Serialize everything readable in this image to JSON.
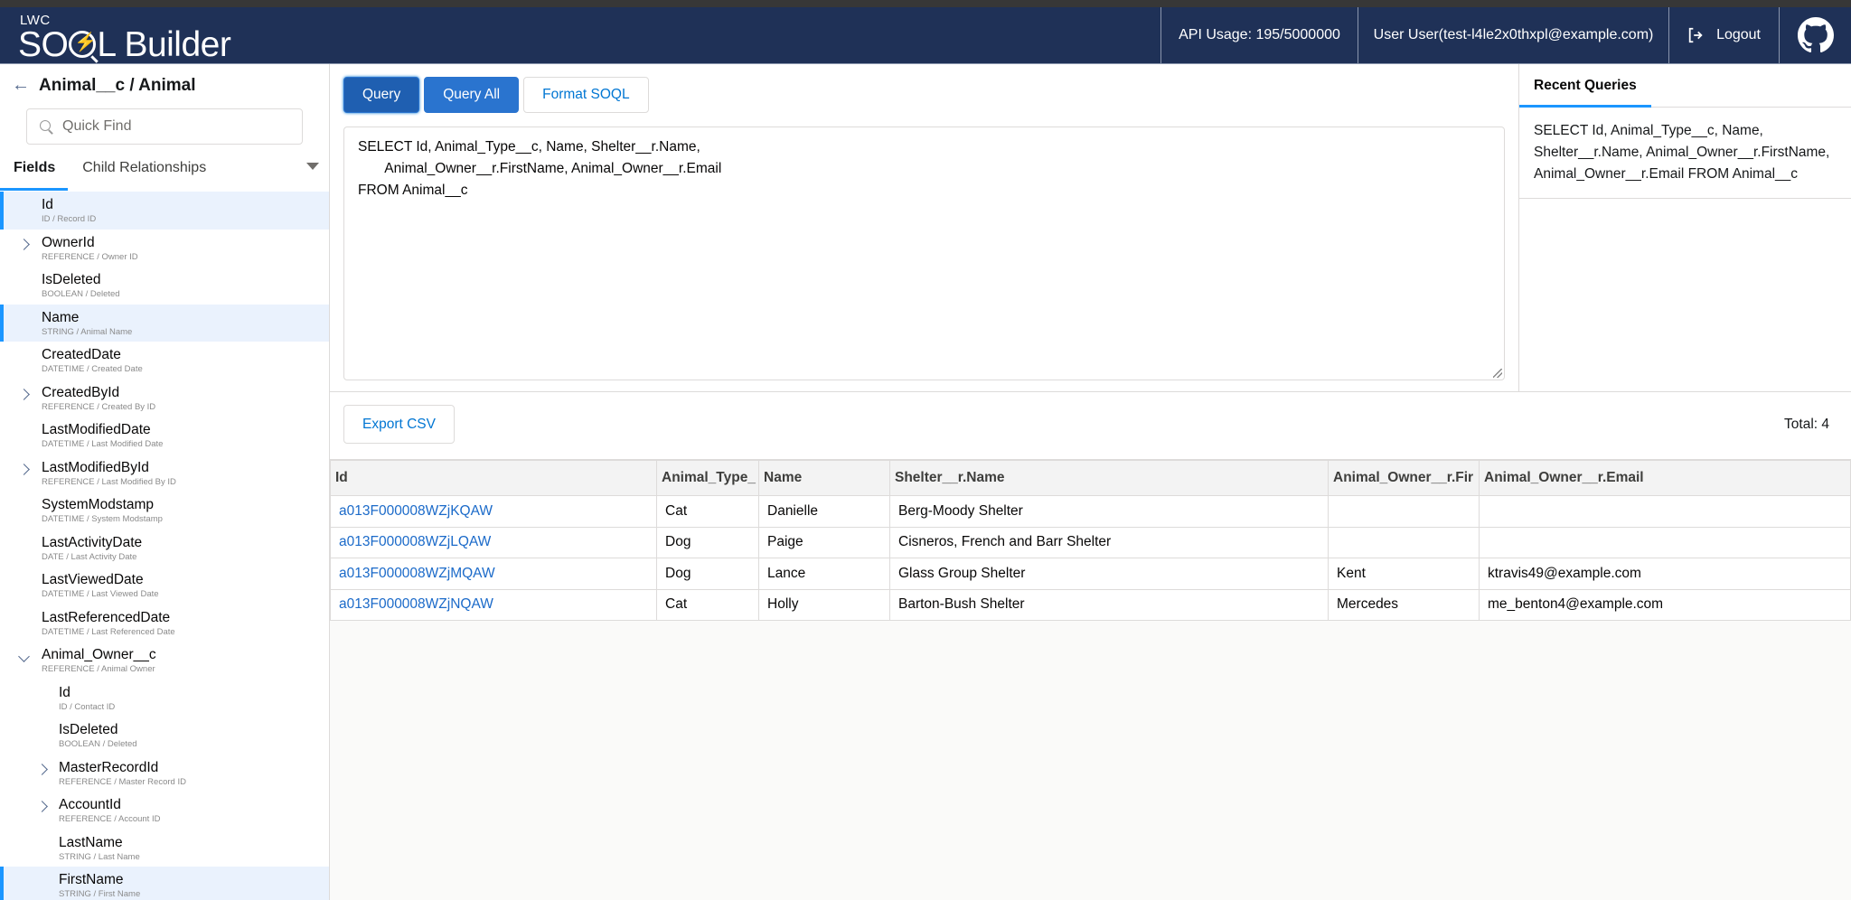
{
  "header": {
    "logo_small": "LWC",
    "logo_title_a": "SO",
    "logo_title_b": "L Builder",
    "api_usage": "API Usage: 195/5000000",
    "user": "User User(test-l4le2x0thxpl@example.com)",
    "logout_label": "Logout"
  },
  "sidebar": {
    "object_title": "Animal__c / Animal",
    "quick_find_placeholder": "Quick Find",
    "tabs": [
      "Fields",
      "Child Relationships"
    ],
    "fields": [
      {
        "name": "Id",
        "desc": "ID / Record ID",
        "level": 0,
        "expand": "none",
        "selected": true
      },
      {
        "name": "OwnerId",
        "desc": "REFERENCE / Owner ID",
        "level": 0,
        "expand": "collapsed",
        "selected": false
      },
      {
        "name": "IsDeleted",
        "desc": "BOOLEAN / Deleted",
        "level": 0,
        "expand": "none",
        "selected": false
      },
      {
        "name": "Name",
        "desc": "STRING / Animal Name",
        "level": 0,
        "expand": "none",
        "selected": true
      },
      {
        "name": "CreatedDate",
        "desc": "DATETIME / Created Date",
        "level": 0,
        "expand": "none",
        "selected": false
      },
      {
        "name": "CreatedById",
        "desc": "REFERENCE / Created By ID",
        "level": 0,
        "expand": "collapsed",
        "selected": false
      },
      {
        "name": "LastModifiedDate",
        "desc": "DATETIME / Last Modified Date",
        "level": 0,
        "expand": "none",
        "selected": false
      },
      {
        "name": "LastModifiedById",
        "desc": "REFERENCE / Last Modified By ID",
        "level": 0,
        "expand": "collapsed",
        "selected": false
      },
      {
        "name": "SystemModstamp",
        "desc": "DATETIME / System Modstamp",
        "level": 0,
        "expand": "none",
        "selected": false
      },
      {
        "name": "LastActivityDate",
        "desc": "DATE / Last Activity Date",
        "level": 0,
        "expand": "none",
        "selected": false
      },
      {
        "name": "LastViewedDate",
        "desc": "DATETIME / Last Viewed Date",
        "level": 0,
        "expand": "none",
        "selected": false
      },
      {
        "name": "LastReferencedDate",
        "desc": "DATETIME / Last Referenced Date",
        "level": 0,
        "expand": "none",
        "selected": false
      },
      {
        "name": "Animal_Owner__c",
        "desc": "REFERENCE / Animal Owner",
        "level": 0,
        "expand": "expanded",
        "selected": false
      },
      {
        "name": "Id",
        "desc": "ID / Contact ID",
        "level": 1,
        "expand": "none",
        "selected": false
      },
      {
        "name": "IsDeleted",
        "desc": "BOOLEAN / Deleted",
        "level": 1,
        "expand": "none",
        "selected": false
      },
      {
        "name": "MasterRecordId",
        "desc": "REFERENCE / Master Record ID",
        "level": 1,
        "expand": "collapsed",
        "selected": false
      },
      {
        "name": "AccountId",
        "desc": "REFERENCE / Account ID",
        "level": 1,
        "expand": "collapsed",
        "selected": false
      },
      {
        "name": "LastName",
        "desc": "STRING / Last Name",
        "level": 1,
        "expand": "none",
        "selected": false
      },
      {
        "name": "FirstName",
        "desc": "STRING / First Name",
        "level": 1,
        "expand": "none",
        "selected": true
      }
    ]
  },
  "editor": {
    "buttons": {
      "query": "Query",
      "query_all": "Query All",
      "format": "Format SOQL"
    },
    "soql": "SELECT Id, Animal_Type__c, Name, Shelter__r.Name,\n       Animal_Owner__r.FirstName, Animal_Owner__r.Email\nFROM Animal__c"
  },
  "recent": {
    "tab_label": "Recent Queries",
    "items": [
      "SELECT Id, Animal_Type__c, Name, Shelter__r.Name, Animal_Owner__r.FirstName, Animal_Owner__r.Email FROM Animal__c"
    ]
  },
  "results": {
    "export_label": "Export CSV",
    "total": "Total: 4",
    "columns": [
      "Id",
      "Animal_Type_",
      "Name",
      "Shelter__r.Name",
      "Animal_Owner__r.Fir",
      "Animal_Owner__r.Email"
    ],
    "rows": [
      [
        "a013F000008WZjKQAW",
        "Cat",
        "Danielle",
        "Berg-Moody Shelter",
        "",
        ""
      ],
      [
        "a013F000008WZjLQAW",
        "Dog",
        "Paige",
        "Cisneros, French and Barr Shelter",
        "",
        ""
      ],
      [
        "a013F000008WZjMQAW",
        "Dog",
        "Lance",
        "Glass Group Shelter",
        "Kent",
        "ktravis49@example.com"
      ],
      [
        "a013F000008WZjNQAW",
        "Cat",
        "Holly",
        "Barton-Bush Shelter",
        "Mercedes",
        "me_benton4@example.com"
      ]
    ]
  },
  "colors": {
    "header_bg": "#1f3157",
    "brand": "#2a74cf",
    "accent": "#1b96ff",
    "link": "#1b6ac9"
  }
}
